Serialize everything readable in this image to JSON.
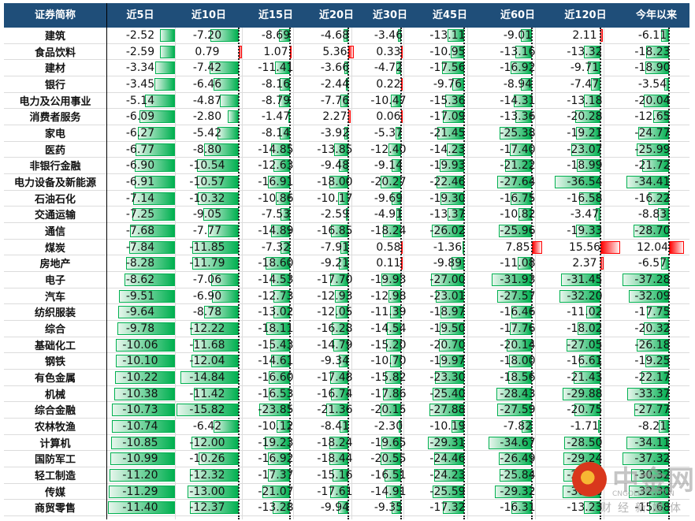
{
  "headers": [
    "证券简称",
    "近5日",
    "近10日",
    "近15日",
    "近20日",
    "近30日",
    "近45日",
    "近60日",
    "近120日",
    "今年以来"
  ],
  "rows": [
    {
      "name": "建筑",
      "values": [
        -2.52,
        -7.2,
        -8.69,
        -4.68,
        -3.46,
        -13.11,
        -9.01,
        2.11,
        -6.11
      ]
    },
    {
      "name": "食品饮料",
      "values": [
        -2.59,
        0.79,
        1.07,
        5.36,
        0.33,
        -10.95,
        -13.16,
        -13.32,
        -18.23
      ]
    },
    {
      "name": "建材",
      "values": [
        -3.34,
        -7.42,
        -11.41,
        -3.66,
        -4.72,
        -17.56,
        -16.92,
        -9.71,
        -18.9
      ]
    },
    {
      "name": "银行",
      "values": [
        -3.45,
        -6.46,
        -8.16,
        -2.44,
        0.22,
        -9.76,
        -8.94,
        -7.47,
        -3.54
      ]
    },
    {
      "name": "电力及公用事业",
      "values": [
        -5.14,
        -4.87,
        -8.79,
        -7.76,
        -10.47,
        -15.36,
        -14.31,
        -13.18,
        -20.04
      ]
    },
    {
      "name": "消费者服务",
      "values": [
        -6.09,
        -2.8,
        -1.47,
        2.27,
        0.06,
        -17.09,
        -13.36,
        -20.28,
        -12.65
      ]
    },
    {
      "name": "家电",
      "values": [
        -6.27,
        -5.42,
        -8.14,
        -3.92,
        -5.37,
        -21.45,
        -25.38,
        -19.21,
        -24.77
      ]
    },
    {
      "name": "医药",
      "values": [
        -6.77,
        -8.8,
        -14.85,
        -13.85,
        -12.4,
        -14.23,
        -17.4,
        -23.07,
        -25.99
      ]
    },
    {
      "name": "非银行金融",
      "values": [
        -6.9,
        -10.54,
        -12.63,
        -9.48,
        -9.14,
        -19.93,
        -21.22,
        -18.99,
        -21.72
      ]
    },
    {
      "name": "电力设备及新能源",
      "values": [
        -6.91,
        -10.57,
        -16.91,
        -18.0,
        -20.27,
        -22.46,
        -27.64,
        -36.54,
        -34.41
      ]
    },
    {
      "name": "石油石化",
      "values": [
        -7.14,
        -10.32,
        -10.86,
        -10.17,
        -9.69,
        -19.3,
        -16.75,
        -16.58,
        -16.22
      ]
    },
    {
      "name": "交通运输",
      "values": [
        -7.25,
        -9.05,
        -7.53,
        -2.59,
        -4.91,
        -13.37,
        -10.82,
        -3.47,
        -8.83
      ]
    },
    {
      "name": "通信",
      "values": [
        -7.68,
        -7.77,
        -14.89,
        -16.85,
        -18.24,
        -26.02,
        -25.96,
        -19.33,
        -28.7
      ]
    },
    {
      "name": "煤炭",
      "values": [
        -7.84,
        -11.85,
        -7.32,
        -7.91,
        0.58,
        -1.36,
        7.85,
        15.56,
        12.04
      ]
    },
    {
      "name": "房地产",
      "values": [
        -8.28,
        -11.79,
        -18.6,
        -9.21,
        0.11,
        -9.89,
        -11.08,
        2.37,
        -6.57
      ]
    },
    {
      "name": "电子",
      "values": [
        -8.62,
        -7.06,
        -14.53,
        -17.7,
        -19.93,
        -27.0,
        -31.93,
        -31.45,
        -37.28
      ]
    },
    {
      "name": "汽车",
      "values": [
        -9.51,
        -6.9,
        -12.73,
        -12.93,
        -12.98,
        -23.01,
        -27.57,
        -32.2,
        -32.09
      ]
    },
    {
      "name": "纺织服装",
      "values": [
        -9.64,
        -8.78,
        -13.02,
        -12.05,
        -11.39,
        -18.97,
        -16.46,
        -11.02,
        -17.75
      ]
    },
    {
      "name": "综合",
      "values": [
        -9.78,
        -12.22,
        -18.11,
        -16.28,
        -14.54,
        -19.5,
        -17.76,
        -18.02,
        -20.32
      ]
    },
    {
      "name": "基础化工",
      "values": [
        -10.06,
        -11.68,
        -15.43,
        -14.79,
        -15.2,
        -20.7,
        -20.14,
        -27.05,
        -26.18
      ]
    },
    {
      "name": "钢铁",
      "values": [
        -10.1,
        -12.04,
        -14.61,
        -9.34,
        -10.7,
        -19.97,
        -18.0,
        -16.61,
        -19.25
      ]
    },
    {
      "name": "有色金属",
      "values": [
        -10.22,
        -14.84,
        -16.6,
        -17.48,
        -15.82,
        -23.3,
        -18.56,
        -21.43,
        -22.17
      ]
    },
    {
      "name": "机械",
      "values": [
        -10.38,
        -11.42,
        -16.53,
        -16.74,
        -17.86,
        -25.4,
        -28.43,
        -29.88,
        -33.37
      ]
    },
    {
      "name": "综合金融",
      "values": [
        -10.73,
        -15.82,
        -23.85,
        -21.36,
        -20.15,
        -27.88,
        -27.59,
        -20.75,
        -27.77
      ]
    },
    {
      "name": "农林牧渔",
      "values": [
        -10.74,
        -6.42,
        -10.12,
        -8.41,
        -2.3,
        -10.19,
        -7.82,
        -1.71,
        -8.21
      ]
    },
    {
      "name": "计算机",
      "values": [
        -10.85,
        -12.0,
        -19.23,
        -18.24,
        -19.65,
        -29.31,
        -34.67,
        -28.5,
        -34.11
      ]
    },
    {
      "name": "国防军工",
      "values": [
        -10.99,
        -10.26,
        -16.92,
        -18.44,
        -20.55,
        -24.46,
        -26.49,
        -29.24,
        -37.32
      ]
    },
    {
      "name": "轻工制造",
      "values": [
        -11.2,
        -12.32,
        -17.37,
        -15.16,
        -16.51,
        -24.23,
        -25.84,
        -29.5,
        -30.32
      ]
    },
    {
      "name": "传媒",
      "values": [
        -11.29,
        -13.0,
        -21.07,
        -17.61,
        -14.91,
        -25.59,
        -29.32,
        -30.1,
        -32.3
      ]
    },
    {
      "name": "商贸零售",
      "values": [
        -11.4,
        -12.37,
        -13.28,
        -9.94,
        -9.35,
        -17.32,
        -16.31,
        -13.23,
        -15.68
      ]
    }
  ],
  "colors": {
    "header_bg": "#1f4e79",
    "negative_bar": "#00b050",
    "positive_bar": "#ff0000"
  },
  "watermark": {
    "brand": "中金网",
    "url": "CNGOLD.COM.CN",
    "tagline": "财经新媒体"
  }
}
